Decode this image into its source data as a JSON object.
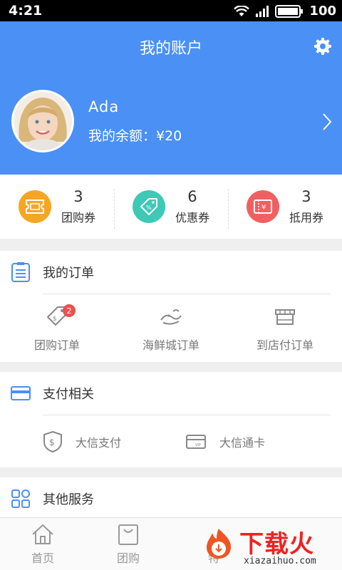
{
  "status_bar": {
    "time": "4:21",
    "battery": "100"
  },
  "header": {
    "title": "我的账户",
    "username": "Ada",
    "balance": "我的余额：¥20"
  },
  "vouchers": [
    {
      "count": "3",
      "label": "团购券",
      "color": "#f5a623",
      "icon": "ticket-icon"
    },
    {
      "count": "6",
      "label": "优惠券",
      "color": "#3ec9b6",
      "icon": "discount-tag-icon"
    },
    {
      "count": "3",
      "label": "抵用券",
      "color": "#f06060",
      "icon": "yuan-voucher-icon"
    }
  ],
  "orders": {
    "title": "我的订单",
    "items": [
      {
        "label": "团购订单",
        "icon": "price-tag-icon",
        "badge": "2"
      },
      {
        "label": "海鲜城订单",
        "icon": "fish-icon"
      },
      {
        "label": "到店付订单",
        "icon": "storefront-icon"
      }
    ]
  },
  "payment": {
    "title": "支付相关",
    "items": [
      {
        "label": "大信支付",
        "icon": "shield-yuan-icon"
      },
      {
        "label": "大信通卡",
        "icon": "vip-card-icon"
      }
    ]
  },
  "other": {
    "title": "其他服务"
  },
  "tabbar": [
    {
      "label": "首页",
      "icon": "home-icon"
    },
    {
      "label": "团购",
      "icon": "shopping-bag-icon"
    },
    {
      "label": "特",
      "icon": "special-icon"
    }
  ],
  "watermark": {
    "title": "下载火",
    "url": "xiazaihuo.com"
  },
  "colors": {
    "primary": "#4a90f5",
    "badge": "#f04e4e",
    "brand_red": "#ee2222"
  }
}
